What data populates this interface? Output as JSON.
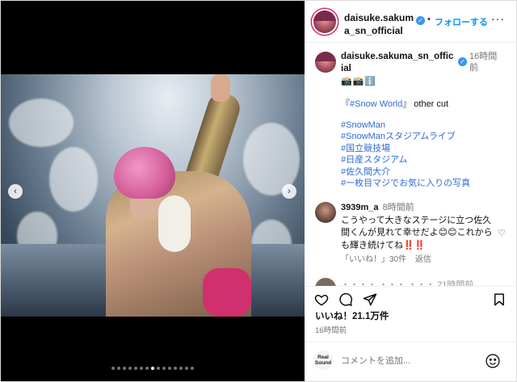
{
  "post": {
    "carousel": {
      "dot_count": 15,
      "active_index": 7
    }
  },
  "header": {
    "username": "daisuke.sakuma_sn_official",
    "separator": "•",
    "follow_label": "フォローする",
    "more_glyph": "···"
  },
  "caption": {
    "username": "daisuke.sakuma_sn_official",
    "time": "16時間前",
    "emoji_line": "📸📸ℹ️",
    "title_prefix": "『",
    "title_tag": "#Snow World",
    "title_suffix": "』 other cut",
    "hashtags": [
      "#SnowMan",
      "#SnowManスタジアムライブ",
      "#国立競技場",
      "#日産スタジアム",
      "#佐久間大介",
      "#一枚目マジでお気に入りの写真"
    ]
  },
  "comment": {
    "username": "3939m_a",
    "time": "8時間前",
    "text": "こうやって大きなステージに立つ佐久間くんが見れて幸せだよ😊😊これからも輝き続けてね",
    "exclaim": "‼️‼️",
    "likes": "「いいね！」30件",
    "reply": "返信"
  },
  "next_comment": {
    "preview": "・・・・ ・・・ ・・・ 21時間前"
  },
  "actions": {
    "icons": [
      "heart-icon",
      "comment-icon",
      "share-icon",
      "bookmark-icon"
    ]
  },
  "stats": {
    "likes": "いいね！21.1万件",
    "time": "16時間前"
  },
  "add_comment": {
    "logo_line1": "Real",
    "logo_line2": "Sound",
    "placeholder": "コメントを追加..."
  },
  "colors": {
    "accent": "#0095f6",
    "verified": "#3897f0",
    "hashtag": "#2f6bd4"
  }
}
